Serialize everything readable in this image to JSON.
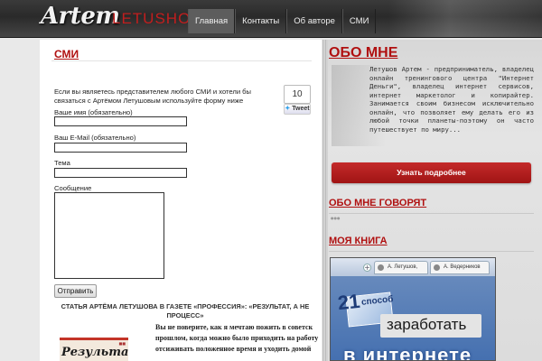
{
  "header": {
    "logo_first": "Artem",
    "logo_last": "LETUSHOV",
    "nav": [
      {
        "label": "Главная",
        "active": true
      },
      {
        "label": "Контакты",
        "active": false
      },
      {
        "label": "Об авторе",
        "active": false
      },
      {
        "label": "СМИ",
        "active": false
      }
    ]
  },
  "main": {
    "title": "СМИ",
    "intro": "Если вы являетесь представителем любого СМИ и хотели бы связаться с Артёмом Летушовым используйте форму ниже",
    "tweet": {
      "count": "10",
      "label": "Tweet",
      "icon": "twitter-bird-icon"
    },
    "form": {
      "name_label": "Ваше имя (обязательно)",
      "email_label": "Ваш E-Mail (обязательно)",
      "subject_label": "Тема",
      "message_label": "Сообщение",
      "submit_label": "Отправить"
    },
    "article": {
      "title": "СТАТЬЯ АРТЁМА ЛЕТУШОВА В ГАЗЕТЕ «ПРОФЕССИЯ»: «РЕЗУЛЬТАТ, А НЕ ПРОЦЕСС»",
      "lines": [
        "Вы не поверите, как я мечтаю пожить в советск",
        "прошлом, когда можно было приходить на работу",
        "отсиживать положенное время и уходить домой"
      ],
      "image_text": "Результат"
    }
  },
  "sidebar": {
    "about_heading": "ОБО МНЕ",
    "about_text": "Летушов Артем - предприниматель, владелец онлайн тренингового центра \"Интернет Деньги\", владелец интернет сервисов, интернет маркетолог и копирайтер. Занимается своим бизнесом исключительно онлайн, что позволяет ему делать его из любой точки планеты-поэтому он часто путешествует по миру...",
    "learn_more_label": "Узнать подробнее",
    "reviews_heading": "ОБО МНЕ ГОВОРЯТ",
    "book_heading": "МОЯ КНИГА",
    "book": {
      "tab1": "А. Летушов,",
      "tab2": "А. Ведерников",
      "number": "21",
      "word": "способ",
      "earn": "заработать",
      "internet": "в интернете"
    }
  }
}
